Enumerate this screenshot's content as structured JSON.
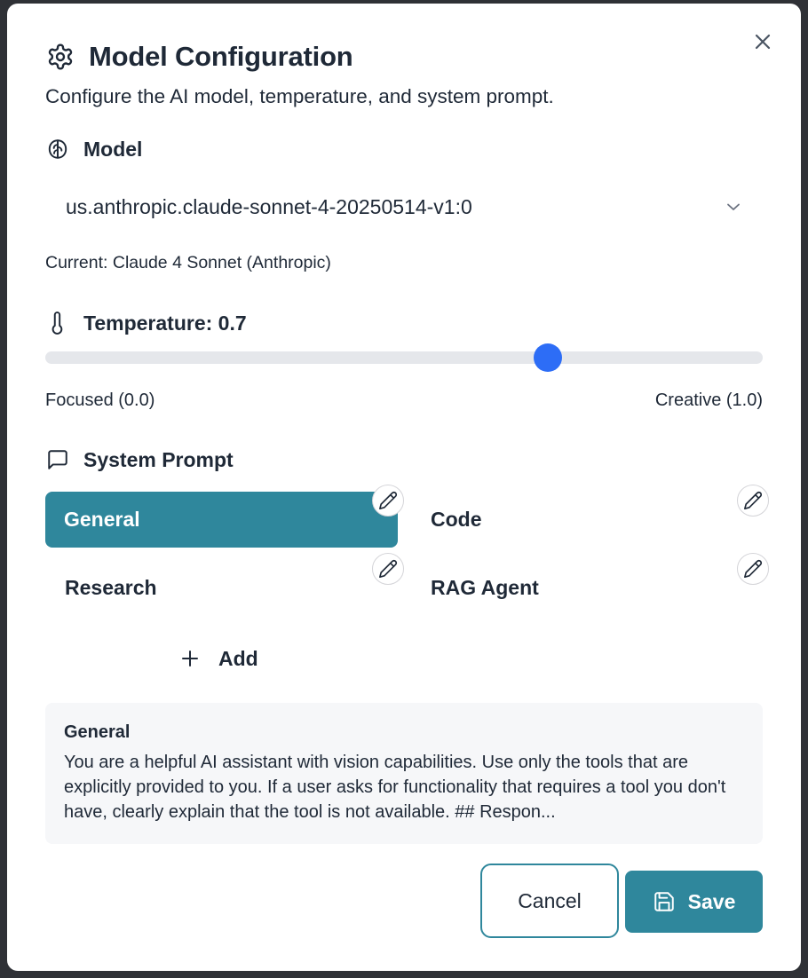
{
  "dialog": {
    "title": "Model Configuration",
    "subtitle": "Configure the AI model, temperature, and system prompt.",
    "title_icon": "gear-icon",
    "close_icon": "close-icon"
  },
  "model": {
    "label": "Model",
    "icon": "brain-icon",
    "selected_value": "us.anthropic.claude-sonnet-4-20250514-v1:0",
    "dropdown_icon": "chevron-down-icon",
    "current_text": "Current: Claude 4 Sonnet (Anthropic)"
  },
  "temperature": {
    "label": "Temperature: 0.7",
    "icon": "thermometer-icon",
    "value": 0.7,
    "min": 0.0,
    "max": 1.0,
    "min_label": "Focused (0.0)",
    "max_label": "Creative (1.0)",
    "accent_color": "#2d6df6"
  },
  "system_prompt": {
    "label": "System Prompt",
    "icon": "message-square-icon",
    "presets": [
      {
        "label": "General",
        "active": true
      },
      {
        "label": "Code",
        "active": false
      },
      {
        "label": "Research",
        "active": false
      },
      {
        "label": "RAG Agent",
        "active": false
      }
    ],
    "edit_icon": "pencil-icon",
    "add_label": "Add",
    "add_icon": "plus-icon",
    "preview_title": "General",
    "preview_text": "You are a helpful AI assistant with vision capabilities. Use only the tools that are explicitly provided to you. If a user asks for functionality that requires a tool you don't have, clearly explain that the tool is not available. ## Respon..."
  },
  "actions": {
    "cancel_label": "Cancel",
    "save_label": "Save",
    "save_icon": "save-icon",
    "primary_color": "#2f879c"
  }
}
